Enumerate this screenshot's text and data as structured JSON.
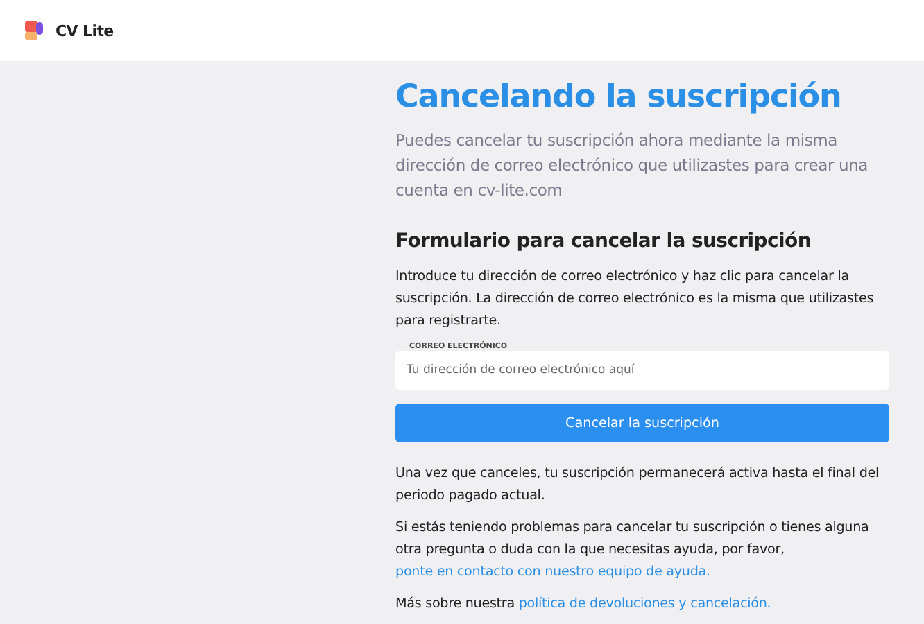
{
  "header": {
    "brand": "CV Lite"
  },
  "title": "Cancelando la suscripción",
  "subtitle": "Puedes cancelar tu suscripción ahora mediante la misma dirección de correo electrónico que utilizastes para crear una cuenta en cv-lite.com",
  "form": {
    "heading": "Formulario para cancelar la suscripción",
    "intro": "Introduce tu dirección de correo electrónico y haz clic para cancelar la suscripción. La dirección de correo electrónico es la misma que utilizastes para registrarte.",
    "email_label": "CORREO ELECTRÓNICO",
    "placeholder": "Tu dirección de correo electrónico aquí",
    "button": "Cancelar la suscripción"
  },
  "notes": [
    [
      {
        "kind": "text",
        "text": "Una vez que canceles, tu suscripción permanecerá activa hasta el final del periodo pagado actual."
      }
    ],
    [
      {
        "kind": "text",
        "text": "Si estás teniendo problemas para cancelar tu suscripción o tienes alguna otra pregunta o duda con la que necesitas ayuda, por favor, "
      },
      {
        "kind": "link",
        "text": "ponte en contacto con nuestro equipo de ayuda."
      }
    ],
    [
      {
        "kind": "text",
        "text": "Más sobre nuestra "
      },
      {
        "kind": "link",
        "text": "política de devoluciones y cancelación."
      }
    ]
  ]
}
